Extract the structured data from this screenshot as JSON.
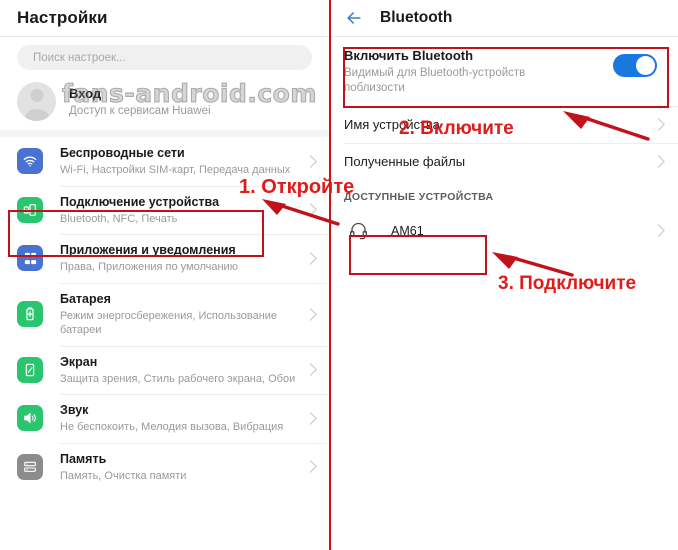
{
  "colors": {
    "accent_blue": "#1878e0",
    "annotation_red": "#c1121c",
    "annotation_text_red": "#e01b1b",
    "icon_green": "#2cc56f",
    "icon_blue": "#4a72d0",
    "icon_gray": "#8c8c8c"
  },
  "watermark": {
    "text": "fans-android.com"
  },
  "left_panel": {
    "header": {
      "title": "Настройки"
    },
    "search": {
      "placeholder": "Поиск настроек...",
      "icon": "search-icon"
    },
    "account": {
      "title": "Вход",
      "subtitle": "Доступ к сервисам Huawei",
      "avatar_icon": "user-avatar-icon"
    },
    "items": [
      {
        "title": "Беспроводные сети",
        "subtitle": "Wi-Fi, Настройки SIM-карт, Передача данных",
        "icon": "wifi-icon",
        "icon_color": "#4a72d0"
      },
      {
        "title": "Подключение устройства",
        "subtitle": "Bluetooth, NFC, Печать",
        "icon": "device-connection-icon",
        "icon_color": "#2cc56f"
      },
      {
        "title": "Приложения и уведомления",
        "subtitle": "Права, Приложения по умолчанию",
        "icon": "apps-grid-icon",
        "icon_color": "#4a72d0"
      },
      {
        "title": "Батарея",
        "subtitle": "Режим энергосбережения, Использование батареи",
        "icon": "battery-icon",
        "icon_color": "#2cc56f"
      },
      {
        "title": "Экран",
        "subtitle": "Защита зрения, Стиль рабочего экрана, Обои",
        "icon": "display-icon",
        "icon_color": "#2cc56f"
      },
      {
        "title": "Звук",
        "subtitle": "Не беспокоить, Мелодия вызова, Вибрация",
        "icon": "sound-speaker-icon",
        "icon_color": "#2cc56f"
      },
      {
        "title": "Память",
        "subtitle": "Память, Очистка памяти",
        "icon": "storage-icon",
        "icon_color": "#8c8c8c"
      }
    ]
  },
  "right_panel": {
    "header": {
      "title": "Bluetooth",
      "back_icon": "back-arrow-icon"
    },
    "enable": {
      "title": "Включить Bluetooth",
      "subtitle": "Видимый для Bluetooth-устройств поблизости",
      "toggle_state": "on"
    },
    "rows": [
      {
        "label": "Имя устройства"
      },
      {
        "label": "Полученные файлы"
      }
    ],
    "available_section": {
      "header": "ДОСТУПНЫЕ УСТРОЙСТВА"
    },
    "devices": [
      {
        "name": "AM61",
        "icon": "headset-icon"
      }
    ]
  },
  "annotations": {
    "step1": {
      "label": "1. Откройте"
    },
    "step2": {
      "label": "2. Включите"
    },
    "step3": {
      "label": "3. Подключите"
    }
  }
}
